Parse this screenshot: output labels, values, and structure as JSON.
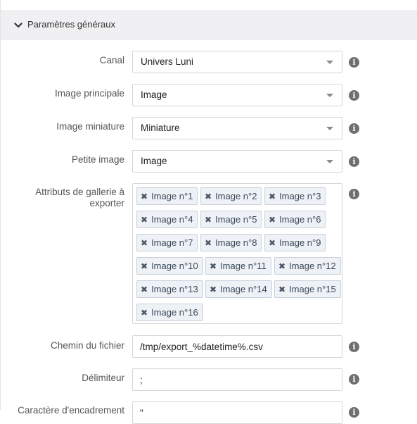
{
  "section": {
    "title": "Paramètres généraux",
    "chevron_icon": "chevron-down-icon"
  },
  "fields": {
    "canal": {
      "label": "Canal",
      "value": "Univers Luni"
    },
    "image_principale": {
      "label": "Image principale",
      "value": "Image"
    },
    "image_miniature": {
      "label": "Image miniature",
      "value": "Miniature"
    },
    "petite_image": {
      "label": "Petite image",
      "value": "Image"
    },
    "gallery": {
      "label_line1": "Attributs de gallerie à",
      "label_line2": "exporter",
      "tags": [
        "Image n°1",
        "Image n°2",
        "Image n°3",
        "Image n°4",
        "Image n°5",
        "Image n°6",
        "Image n°7",
        "Image n°8",
        "Image n°9",
        "Image n°10",
        "Image n°11",
        "Image n°12",
        "Image n°13",
        "Image n°14",
        "Image n°15",
        "Image n°16"
      ]
    },
    "chemin": {
      "label": "Chemin du fichier",
      "value": "/tmp/export_%datetime%.csv"
    },
    "delimiteur": {
      "label": "Délimiteur",
      "value": ";"
    },
    "encadrement": {
      "label": "Caractère d'encadrement",
      "value": "\""
    }
  },
  "icons": {
    "info": "info-icon",
    "remove": "remove-tag-icon",
    "dropdown": "caret-down-icon"
  },
  "glyphs": {
    "info": "i",
    "remove": "✖"
  }
}
